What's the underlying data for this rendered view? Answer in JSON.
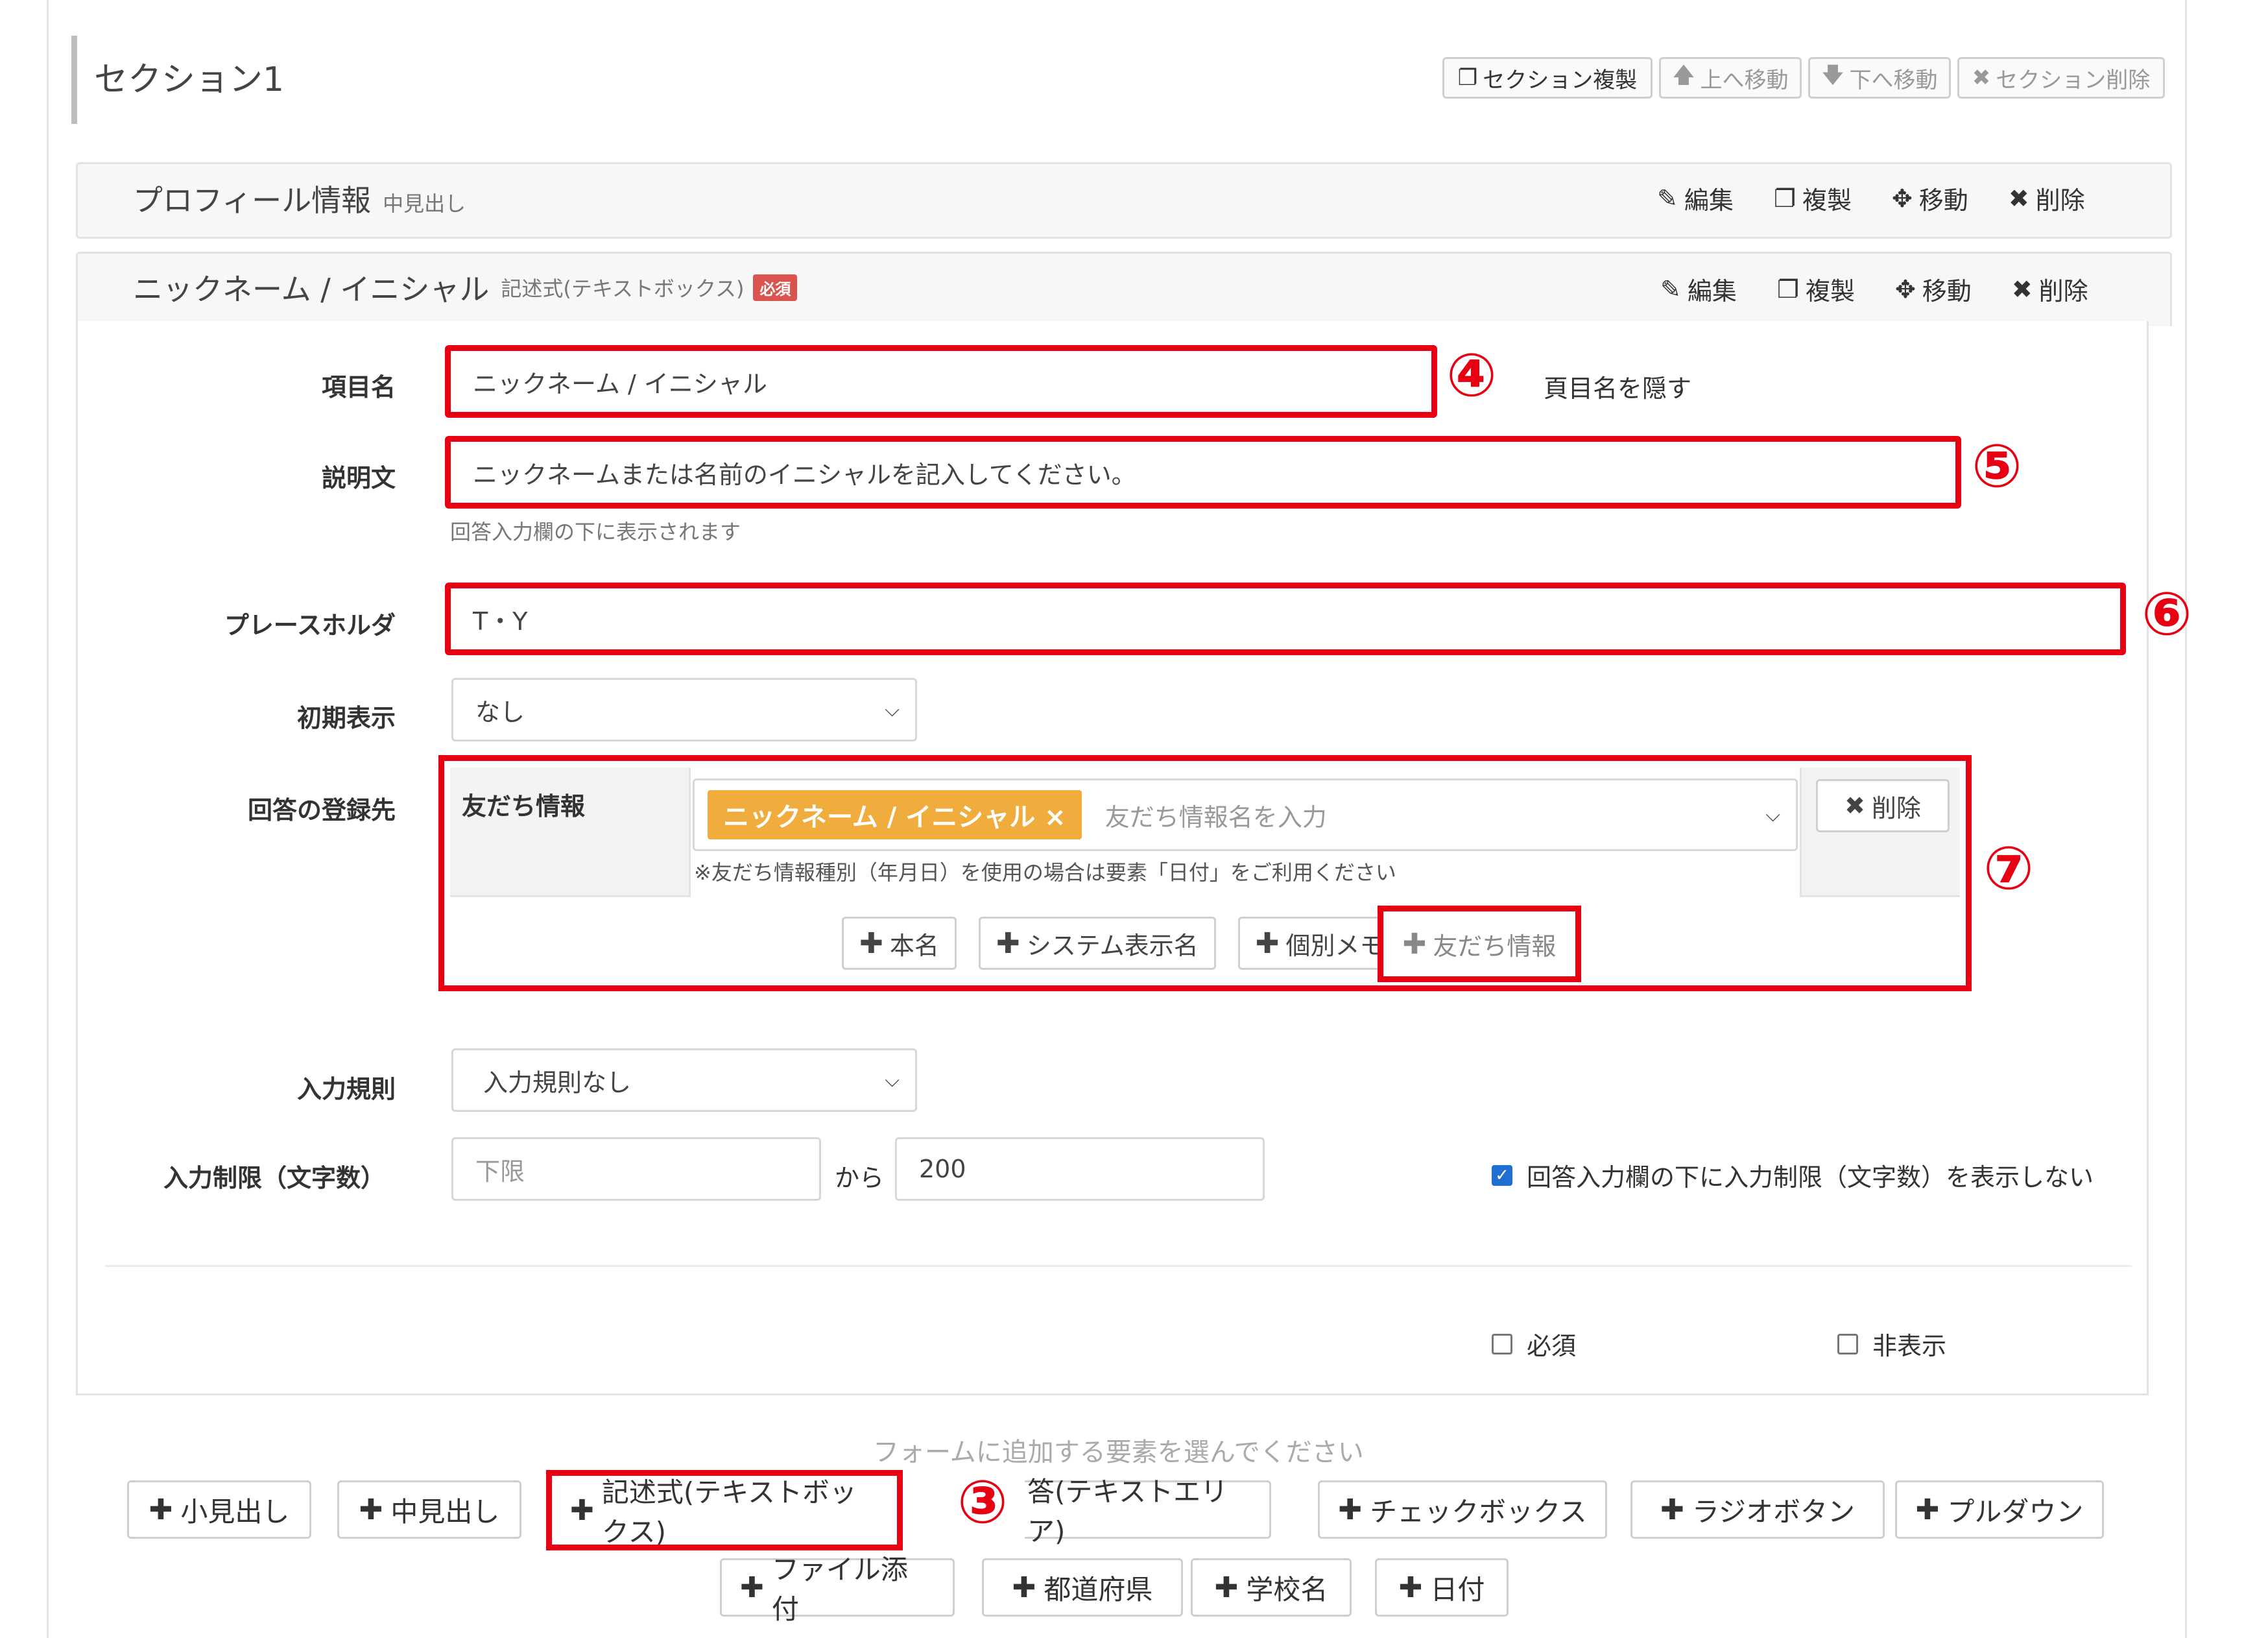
{
  "section": {
    "title": "セクション1",
    "buttons": [
      "セクション複製",
      "上へ移動",
      "下へ移動",
      "セクション削除"
    ]
  },
  "profile_panel": {
    "title": "プロフィール情報",
    "subtitle": "中見出し",
    "actions": [
      "編集",
      "複製",
      "移動",
      "削除"
    ]
  },
  "item_panel": {
    "title": "ニックネーム / イニシャル",
    "type_label": "記述式(テキストボックス)",
    "required_badge": "必須",
    "actions": [
      "編集",
      "複製",
      "移動",
      "削除"
    ]
  },
  "form": {
    "item_name_label": "項目名",
    "item_name_value": "ニックネーム / イニシャル",
    "hide_name_text": "頁目名を隠す",
    "desc_label": "説明文",
    "desc_value": "ニックネームまたは名前のイニシャルを記入してください。",
    "desc_hint": "回答入力欄の下に表示されます",
    "placeholder_label": "プレースホルダ",
    "placeholder_value": "T・Y",
    "initial_label": "初期表示",
    "initial_value": "なし",
    "register_label": "回答の登録先",
    "friend_info_label": "友だち情報",
    "tag_text": "ニックネーム / イニシャル ×",
    "tag_input_placeholder": "友だち情報名を入力",
    "delete_btn": "削除",
    "register_note": "※友だち情報種別（年月日）を使用の場合は要素「日付」をご利用ください",
    "add_buttons": [
      "本名",
      "システム表示名",
      "個別メモ",
      "友だち情報"
    ],
    "rule_label": "入力規則",
    "rule_value": "入力規則なし",
    "limit_label": "入力制限（文字数）",
    "limit_min_placeholder": "下限",
    "limit_from": "から",
    "limit_max_value": "200",
    "limit_hide_text": "回答入力欄の下に入力制限（文字数）を表示しない",
    "required_text": "必須",
    "hidden_text": "非表示"
  },
  "annotations": [
    "④",
    "⑤",
    "⑥",
    "⑦",
    "③"
  ],
  "add_elements": {
    "prompt": "フォームに追加する要素を選んでください",
    "row1": [
      "小見出し",
      "中見出し",
      "記述式(テキストボックス)",
      "答(テキストエリア)",
      "チェックボックス",
      "ラジオボタン",
      "プルダウン"
    ],
    "row2": [
      "ファイル添付",
      "都道府県",
      "学校名",
      "日付"
    ]
  },
  "colors": {
    "annotation_red": "#e60012",
    "tag_orange": "#f0ad3e",
    "checkbox_blue": "#1f6fd1"
  }
}
